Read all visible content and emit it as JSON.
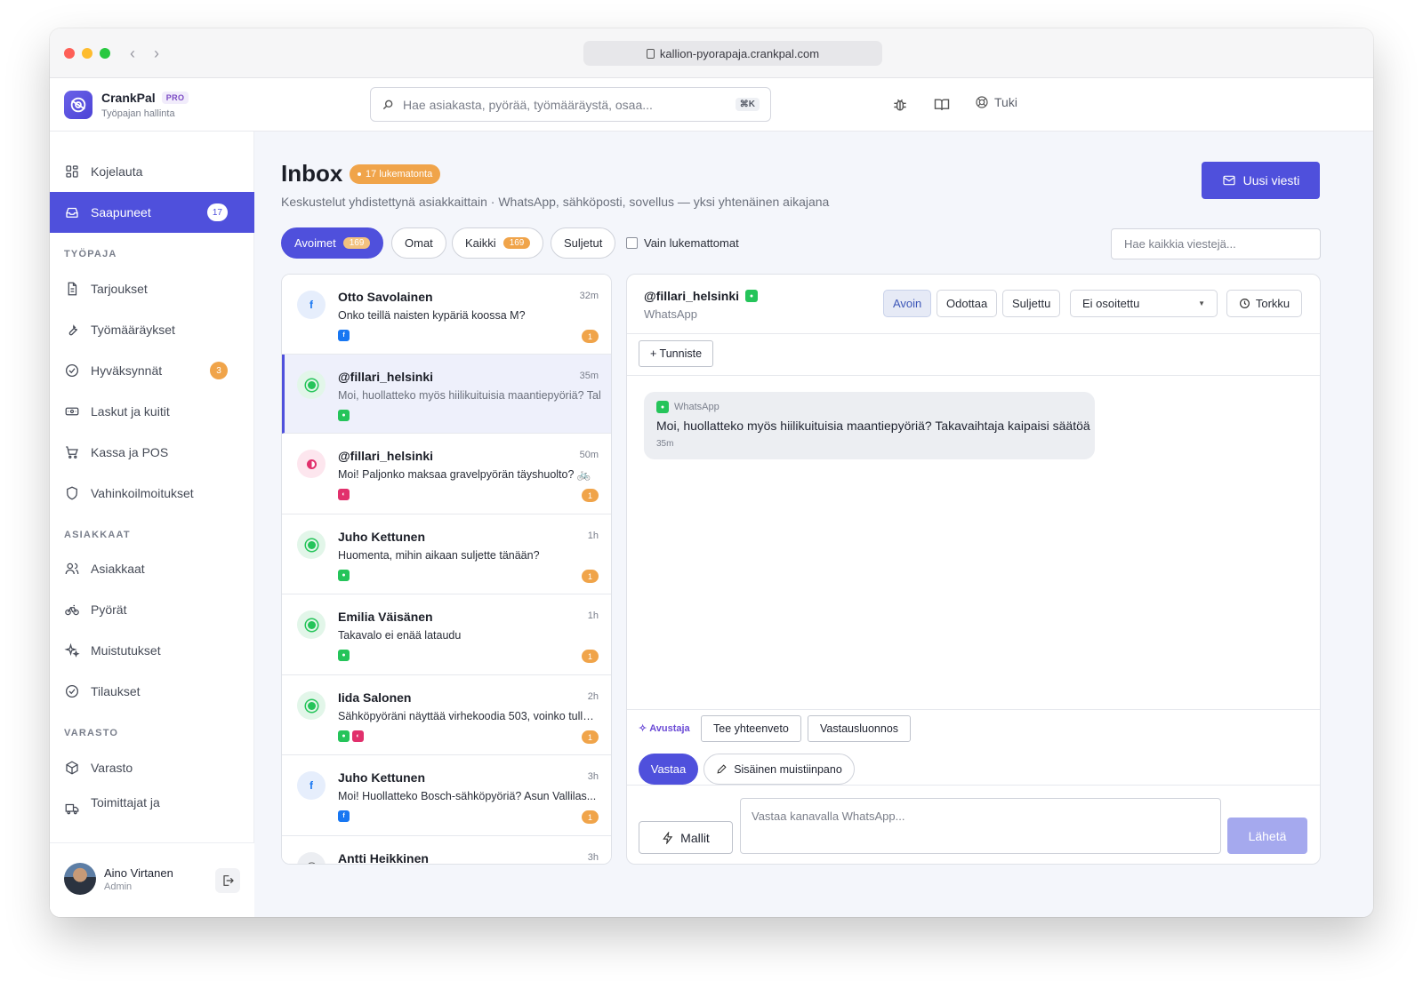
{
  "browser": {
    "url": "kallion-pyorapaja.crankpal.com"
  },
  "brand": {
    "name": "CrankPal",
    "tier": "PRO",
    "subtitle": "Työpajan hallinta"
  },
  "header": {
    "search_placeholder": "Hae asiakasta, pyörää, työmääräystä, osaa...",
    "shortcut": "⌘K",
    "support_label": "Tuki"
  },
  "sidebar": {
    "top": [
      {
        "label": "Kojelauta",
        "icon": "grid-icon"
      },
      {
        "label": "Saapuneet",
        "icon": "inbox-icon",
        "badge": "17",
        "active": true
      }
    ],
    "sections": [
      {
        "title": "TYÖPAJA",
        "items": [
          {
            "label": "Tarjoukset",
            "icon": "document-icon"
          },
          {
            "label": "Työmääräykset",
            "icon": "wrench-icon"
          },
          {
            "label": "Hyväksynnät",
            "icon": "check-circle-icon",
            "badge": "3"
          },
          {
            "label": "Laskut ja kuitit",
            "icon": "receipt-icon"
          },
          {
            "label": "Kassa ja POS",
            "icon": "cart-icon"
          },
          {
            "label": "Vahinkoilmoitukset",
            "icon": "shield-icon"
          }
        ]
      },
      {
        "title": "ASIAKKAAT",
        "items": [
          {
            "label": "Asiakkaat",
            "icon": "users-icon"
          },
          {
            "label": "Pyörät",
            "icon": "bike-icon"
          },
          {
            "label": "Muistutukset",
            "icon": "sparkles-icon"
          },
          {
            "label": "Tilaukset",
            "icon": "check-circle-icon"
          }
        ]
      },
      {
        "title": "VARASTO",
        "items": [
          {
            "label": "Varasto",
            "icon": "box-icon"
          },
          {
            "label": "Toimittajat ja",
            "icon": "truck-icon"
          }
        ]
      }
    ],
    "user": {
      "name": "Aino Virtanen",
      "role": "Admin"
    }
  },
  "page": {
    "title": "Inbox",
    "unread_badge": "17 lukematonta",
    "subtitle": "Keskustelut yhdistettynä asiakkaittain · WhatsApp, sähköposti, sovellus — yksi yhtenäinen aikajana",
    "new_button": "Uusi viesti"
  },
  "filters": {
    "tabs": [
      {
        "label": "Avoimet",
        "count": "169",
        "active": true
      },
      {
        "label": "Omat"
      },
      {
        "label": "Kaikki",
        "count": "169"
      },
      {
        "label": "Suljetut"
      }
    ],
    "unread_only_label": "Vain lukemattomat",
    "search_placeholder": "Hae kaikkia viestejä..."
  },
  "conversations": [
    {
      "name": "Otto Savolainen",
      "time": "32m",
      "preview": "Onko teillä naisten kypäriä koossa M?",
      "avatar": "facebook-icon",
      "channels": [
        "facebook"
      ],
      "unread": "1"
    },
    {
      "name": "@fillari_helsinki",
      "time": "35m",
      "preview": "Moi, huollatteko myös hiilikuituisia maantiepyöriä? Takavaihtaja kaipaisi säätöä",
      "avatar": "whatsapp-icon",
      "channels": [
        "whatsapp"
      ],
      "selected": true
    },
    {
      "name": "@fillari_helsinki",
      "time": "50m",
      "preview": "Moi! Paljonko maksaa gravelpyörän täyshuolto? 🚲",
      "avatar": "instagram-icon",
      "channels": [
        "instagram"
      ],
      "unread": "1"
    },
    {
      "name": "Juho Kettunen",
      "time": "1h",
      "preview": "Huomenta, mihin aikaan suljette tänään?",
      "avatar": "whatsapp-icon",
      "channels": [
        "whatsapp"
      ],
      "unread": "1"
    },
    {
      "name": "Emilia Väisänen",
      "time": "1h",
      "preview": "Takavalo ei enää lataudu",
      "avatar": "whatsapp-icon",
      "channels": [
        "whatsapp"
      ],
      "unread": "1"
    },
    {
      "name": "Iida Salonen",
      "time": "2h",
      "preview": "Sähköpyöräni näyttää virhekoodia 503, voinko tulla...",
      "avatar": "whatsapp-icon",
      "channels": [
        "whatsapp",
        "instagram"
      ],
      "unread": "1"
    },
    {
      "name": "Juho Kettunen",
      "time": "3h",
      "preview": "Moi! Huollatteko Bosch-sähköpyöriä? Asun Vallilas...",
      "avatar": "facebook-icon",
      "channels": [
        "facebook"
      ],
      "unread": "1"
    },
    {
      "name": "Antti Heikkinen",
      "time": "3h",
      "preview": "",
      "avatar": "email-icon",
      "channels": []
    }
  ],
  "thread": {
    "contact": "@fillari_helsinki",
    "channel": "WhatsApp",
    "status_buttons": [
      "Avoin",
      "Odottaa",
      "Suljettu"
    ],
    "active_status": "Avoin",
    "assignee": "Ei osoitettu",
    "snooze": "Torkku",
    "tag_button": "+ Tunniste",
    "message": {
      "channel": "WhatsApp",
      "text": "Moi, huollatteko myös hiilikuituisia maantiepyöriä? Takavaihtaja kaipaisi säätöä",
      "time": "35m"
    },
    "assistant": {
      "label": "Avustaja",
      "summary": "Tee yhteenveto",
      "draft": "Vastausluonnos"
    },
    "reply_tab": "Vastaa",
    "note_tab": "Sisäinen muistiinpano",
    "templates": "Mallit",
    "composer_placeholder": "Vastaa kanavalla WhatsApp...",
    "send": "Lähetä"
  },
  "colors": {
    "accent": "#4f50dc",
    "badge": "#f0a44a",
    "whatsapp": "#25c45a",
    "facebook": "#1877f2",
    "instagram": "#e1306c"
  }
}
